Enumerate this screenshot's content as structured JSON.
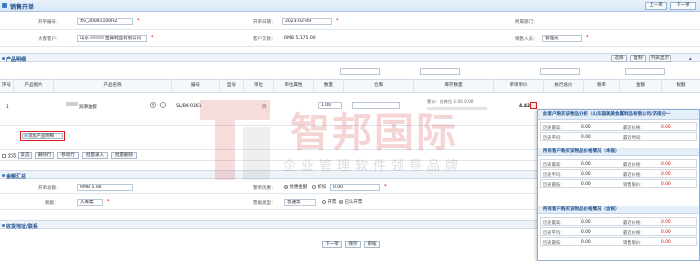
{
  "window": {
    "title": "销售开单",
    "btn_prev": "上一单",
    "btn_next": "下一单"
  },
  "header": {
    "order_no_label": "开单编号：",
    "order_no_value": "XS_20081100HZ",
    "date_label": "开单日期：",
    "date_value": "2023-02-09",
    "dept_label": "所属部门：",
    "customer_label": "大客客户：",
    "customer_value": "山东",
    "customer_value2": "金属制品有限公司",
    "balance_label": "客户欠款：",
    "balance_value": "RMB 5,175.00",
    "sales_label": "销售人员：",
    "sales_value": "管理员"
  },
  "products_section": {
    "title": "产品明细",
    "toolbar": [
      "选择",
      "复制",
      "列表显示"
    ],
    "columns": [
      "序号",
      "产品图片",
      "产品名称",
      "编号",
      "型号",
      "单位",
      "单位属性",
      "数量",
      "仓库",
      "库存数量",
      "单项单价",
      "执行总价",
      "税率",
      "金额",
      "税额"
    ],
    "row": {
      "index": "1",
      "name": "润滑油套",
      "code": "SL/BK-0361",
      "unit": "只",
      "qty": "1.00",
      "stock_text": "累计：仓库位 1.00 0.00",
      "price": "4.42"
    },
    "add_product": "添加产品明细",
    "footer_buttons": [
      "全选",
      "反选",
      "删除行",
      "移动行",
      "批量录入",
      "批量删除"
    ]
  },
  "summary_section": {
    "title": "金额汇总",
    "total_label": "开单总额：",
    "total_value": "RMB 5.00",
    "discount_label": "整单优惠：",
    "discount_opt1": "优惠金额",
    "discount_opt2": "折扣",
    "discount_value": "0.00",
    "tax_label": "税额：",
    "tax_value": "入库类",
    "invoice_label": "票据类型：",
    "invoice_value": "普通票",
    "invoice_opt1": "开票",
    "invoice_opt2": "已认开票"
  },
  "address_section": {
    "title": "收货地址/联系"
  },
  "bottom_buttons": [
    "下一单",
    "保存",
    "审核"
  ],
  "popup": {
    "title": "此客户购买该物品分析（山东国美美金属制品有限公司/济南分一",
    "block1": {
      "rows": [
        {
          "label": "历史最高：",
          "value": "0.00",
          "label2": "最近价格：",
          "value2": "0.00"
        },
        {
          "label": "历史平均：",
          "value": "0.00",
          "label2": "最近时间：",
          "value2": ""
        }
      ]
    },
    "block2": {
      "title": "所有客户购买该物品价格情况（本报）",
      "rows": [
        {
          "label": "历史最高：",
          "value": "0.00",
          "label2": "最近价格：",
          "value2": "0.00"
        },
        {
          "label": "历史平均：",
          "value": "0.00",
          "label2": "最近价格：",
          "value2": "0.00"
        },
        {
          "label": "历史最低：",
          "value": "0.00",
          "label2": "销售限价：",
          "value2": "0.00"
        }
      ]
    },
    "block3": {
      "title": "所有客户购买该物品价格情况（含税）",
      "rows": [
        {
          "label": "历史最高：",
          "value": "0.00",
          "label2": "最近价格：",
          "value2": "0.00"
        },
        {
          "label": "历史平均：",
          "value": "0.00",
          "label2": "最近价格：",
          "value2": "0.00"
        },
        {
          "label": "历史最低：",
          "value": "0.00",
          "label2": "销售限价：",
          "value2": "0.00"
        }
      ]
    }
  },
  "watermark": {
    "text": "智邦国际",
    "subtitle": "企业管理软件领导品牌"
  }
}
